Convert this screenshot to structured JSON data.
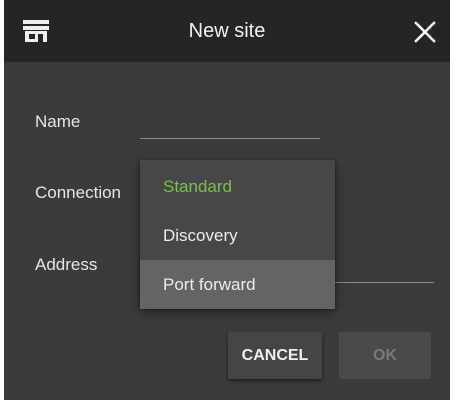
{
  "dialog": {
    "title": "New site",
    "icons": {
      "app": "storefront-icon",
      "close": "close-icon"
    }
  },
  "form": {
    "name": {
      "label": "Name",
      "value": ""
    },
    "connection": {
      "label": "Connection",
      "options": [
        "Standard",
        "Discovery",
        "Port forward"
      ],
      "selected": "Standard",
      "hovered": "Port forward"
    },
    "address": {
      "label": "Address",
      "value": ""
    }
  },
  "buttons": {
    "cancel": "CANCEL",
    "ok": "OK"
  },
  "colors": {
    "background": "#3b3b3b",
    "titlebar": "#252525",
    "selected_option": "#7cc04a",
    "hovered_option": "#646464"
  }
}
